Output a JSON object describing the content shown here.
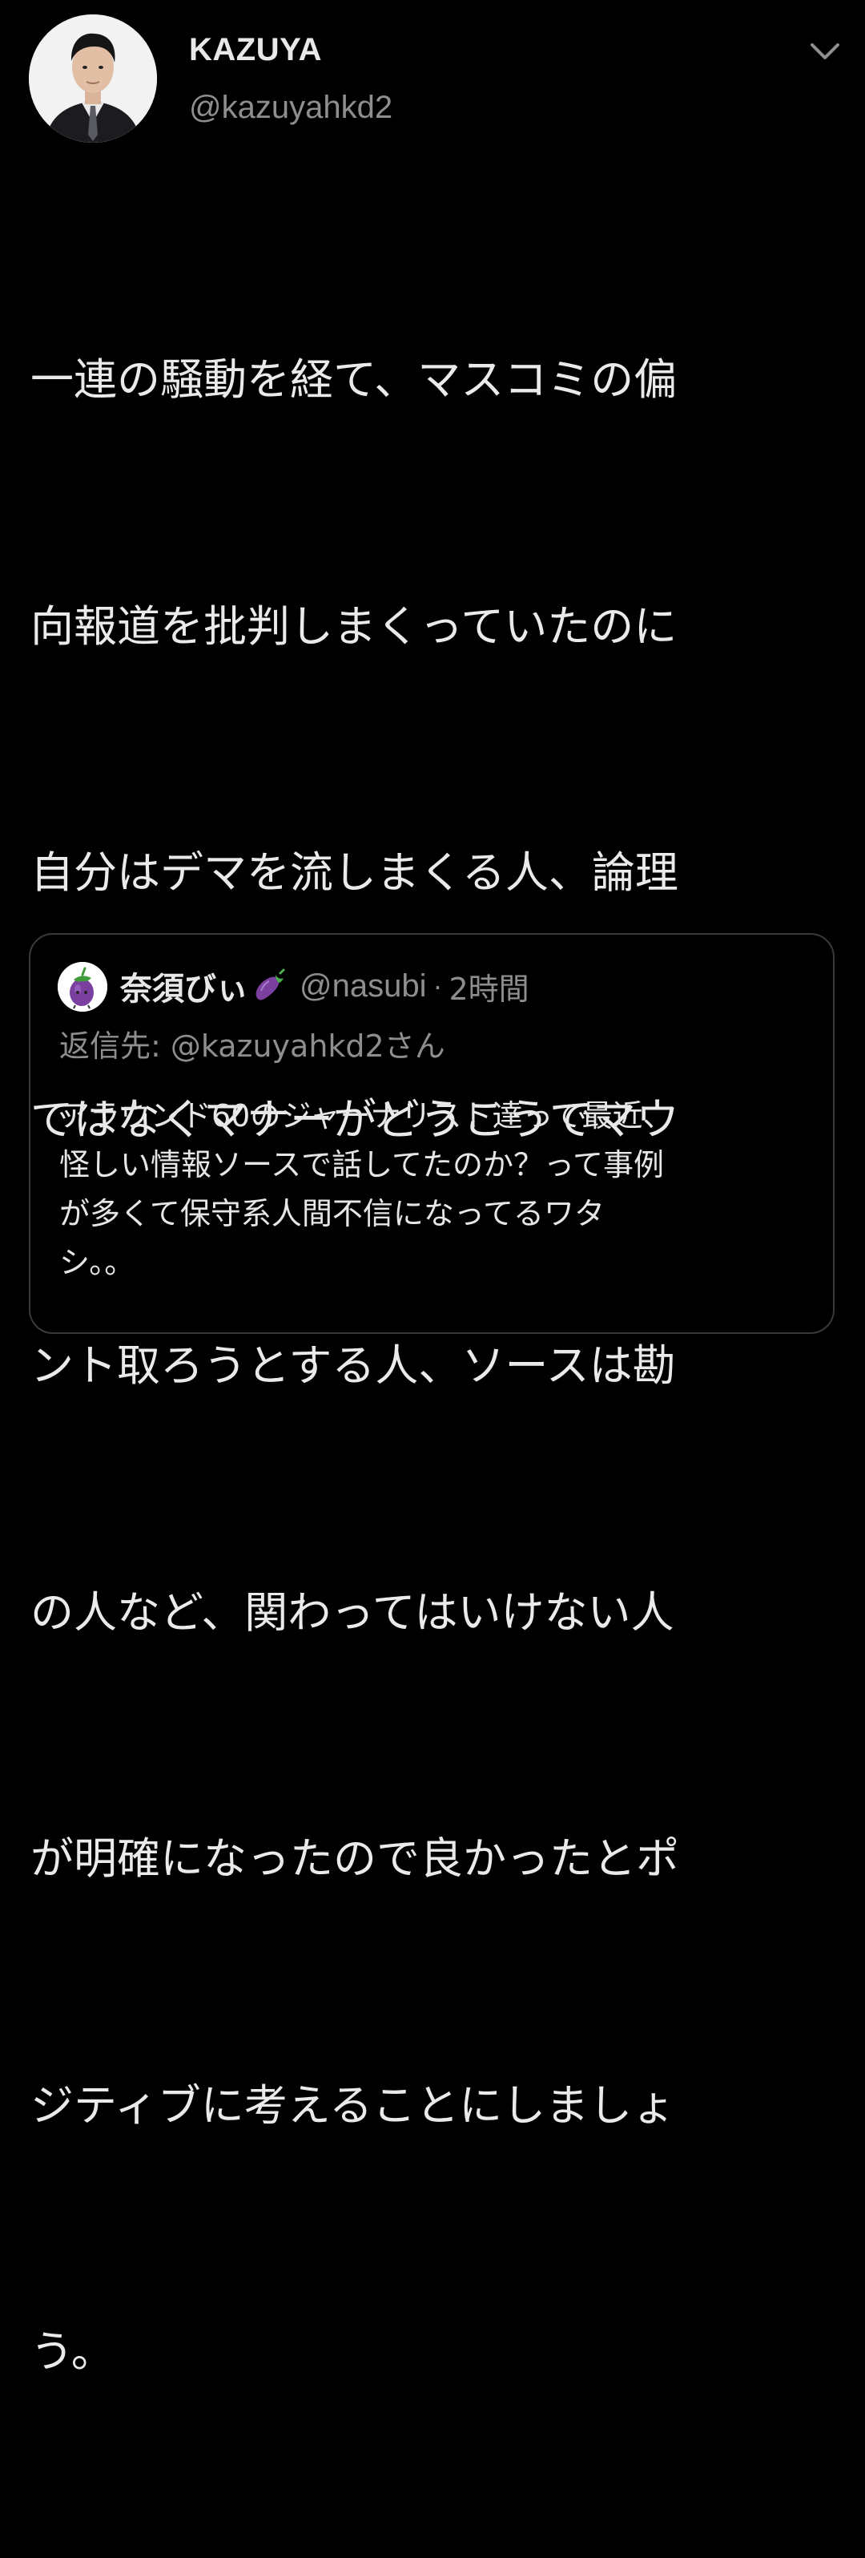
{
  "tweet": {
    "display_name": "KAZUYA",
    "handle": "@kazuyahkd2",
    "avatar_icon": "user-avatar-photo",
    "menu_icon": "chevron-down-icon",
    "text_lines": [
      "一連の騒動を経て、マスコミの偏",
      "向報道を批判しまくっていたのに",
      "自分はデマを流しまくる人、論理",
      "ではなくマナーがどうこうでマウ",
      "ント取ろうとする人、ソースは勘",
      "の人など、関わってはいけない人",
      "が明確になったので良かったとポ",
      "ジティブに考えることにしましょ",
      "う。"
    ]
  },
  "quote": {
    "display_name": "奈須びぃ",
    "name_emoji": "eggplant-emoji",
    "avatar_icon": "eggplant-avatar-icon",
    "handle": "@nasubi",
    "separator": "·",
    "time": "2時間",
    "reply_prefix": "返信先: ",
    "reply_handle": "@kazuyahkd2さん",
    "text_lines": [
      "アラウンド60のジャーナリスト達って最近、",
      "怪しい情報ソースで話してたのか？って事例",
      "が多くて保守系人間不信になってるワタ",
      "シ。。"
    ]
  },
  "colors": {
    "background": "#000000",
    "primary_text": "#eaeaea",
    "secondary_text": "#8e8e8e",
    "quote_border": "#3a3a3a",
    "eggplant": "#7b3fa0"
  }
}
